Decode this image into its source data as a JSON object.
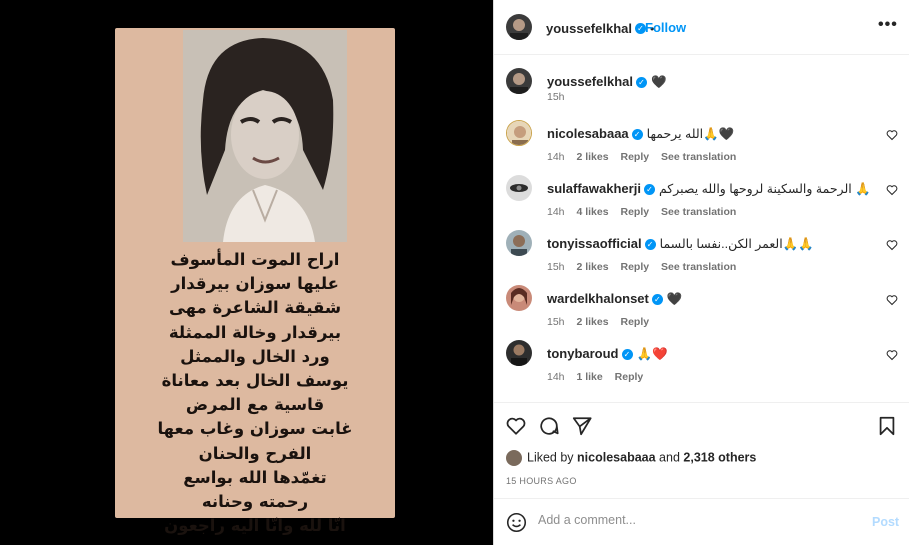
{
  "post": {
    "poem_lines": [
      "اراح الموت المأسوف",
      "عليها سوزان بيرقدار",
      "شقيقة الشاعرة مهى",
      "بيرقدار وخالة الممثلة",
      "ورد الخال والممثل",
      "يوسف الخال بعد معاناة",
      "قاسية مع المرض",
      "غابت سوزان وغاب معها",
      "الفرح والحنان",
      "تغمّدها الله بواسع",
      "رحمته وحنانه",
      "انّا لله وانّا اليه راجعون"
    ]
  },
  "header": {
    "username": "youssefelkhal",
    "follow_label": "Follow",
    "more_label": "•••"
  },
  "caption": {
    "username": "youssefelkhal",
    "text": "🖤",
    "time": "15h"
  },
  "comments": [
    {
      "username": "nicolesabaaa",
      "text": "الله يرحمها🙏🖤",
      "time": "14h",
      "likes": "2 likes",
      "reply": "Reply",
      "translation": "See translation"
    },
    {
      "username": "sulaffawakherji",
      "text": "الرحمة والسكينة لروحها والله يصبركم 🙏",
      "time": "14h",
      "likes": "4 likes",
      "reply": "Reply",
      "translation": "See translation"
    },
    {
      "username": "tonyissaofficial",
      "text": "العمر الكن..نفسا بالسما🙏🙏",
      "time": "15h",
      "likes": "2 likes",
      "reply": "Reply",
      "translation": "See translation"
    },
    {
      "username": "wardelkhalonset",
      "text": "🖤",
      "time": "15h",
      "likes": "2 likes",
      "reply": "Reply",
      "translation": ""
    },
    {
      "username": "tonybaroud",
      "text": "🙏❤️",
      "time": "14h",
      "likes": "1 like",
      "reply": "Reply",
      "translation": ""
    }
  ],
  "likes": {
    "prefix": "Liked by",
    "user": "nicolesabaaa",
    "and": "and",
    "others": "2,318 others"
  },
  "timestamp": "15 HOURS AGO",
  "composer": {
    "placeholder": "Add a comment...",
    "post_label": "Post"
  },
  "colors": {
    "accent": "#0095f6",
    "post_disabled": "#b3dbff",
    "card_background": "#ddb9a0",
    "muted_text": "#737373"
  },
  "icons": [
    "more-icon",
    "heart-icon",
    "comment-icon",
    "share-icon",
    "bookmark-icon",
    "emoji-icon",
    "verified-badge-icon"
  ]
}
